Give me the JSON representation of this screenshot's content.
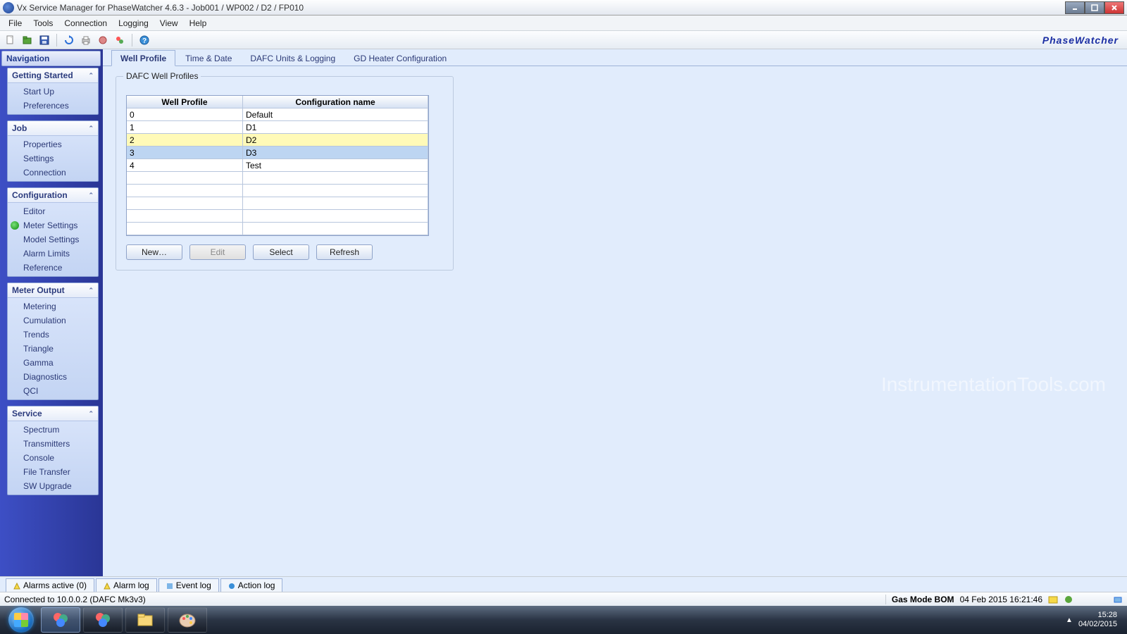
{
  "window": {
    "title": "Vx Service Manager for PhaseWatcher 4.6.3 - Job001 / WP002 / D2 / FP010"
  },
  "menu": {
    "file": "File",
    "tools": "Tools",
    "connection": "Connection",
    "logging": "Logging",
    "view": "View",
    "help": "Help"
  },
  "brand": "PhaseWatcher",
  "nav": {
    "title": "Navigation",
    "groups": [
      {
        "title": "Getting Started",
        "items": [
          "Start Up",
          "Preferences"
        ]
      },
      {
        "title": "Job",
        "items": [
          "Properties",
          "Settings",
          "Connection"
        ]
      },
      {
        "title": "Configuration",
        "items": [
          "Editor",
          "Meter Settings",
          "Model Settings",
          "Alarm Limits",
          "Reference"
        ],
        "active_index": 1
      },
      {
        "title": "Meter Output",
        "items": [
          "Metering",
          "Cumulation",
          "Trends",
          "Triangle",
          "Gamma",
          "Diagnostics",
          "QCI"
        ]
      },
      {
        "title": "Service",
        "items": [
          "Spectrum",
          "Transmitters",
          "Console",
          "File Transfer",
          "SW Upgrade"
        ]
      }
    ]
  },
  "tabs": {
    "well_profile": "Well Profile",
    "time_date": "Time & Date",
    "dafc": "DAFC Units & Logging",
    "gd": "GD Heater Configuration"
  },
  "group": {
    "legend": "DAFC Well Profiles",
    "cols": {
      "profile": "Well Profile",
      "config": "Configuration name"
    },
    "rows": [
      {
        "p": "0",
        "c": "Default"
      },
      {
        "p": "1",
        "c": "D1"
      },
      {
        "p": "2",
        "c": "D2"
      },
      {
        "p": "3",
        "c": "D3"
      },
      {
        "p": "4",
        "c": "Test"
      }
    ],
    "buttons": {
      "new": "New…",
      "edit": "Edit",
      "select": "Select",
      "refresh": "Refresh"
    }
  },
  "watermark": "InstrumentationTools.com",
  "bottom_tabs": {
    "alarms_active": "Alarms active (0)",
    "alarm_log": "Alarm log",
    "event_log": "Event log",
    "action_log": "Action log"
  },
  "status": {
    "left": "Connected to 10.0.0.2 (DAFC Mk3v3)",
    "mode": "Gas Mode  BOM",
    "timestamp": "04 Feb 2015 16:21:46"
  },
  "tray": {
    "time": "15:28",
    "date": "04/02/2015"
  }
}
